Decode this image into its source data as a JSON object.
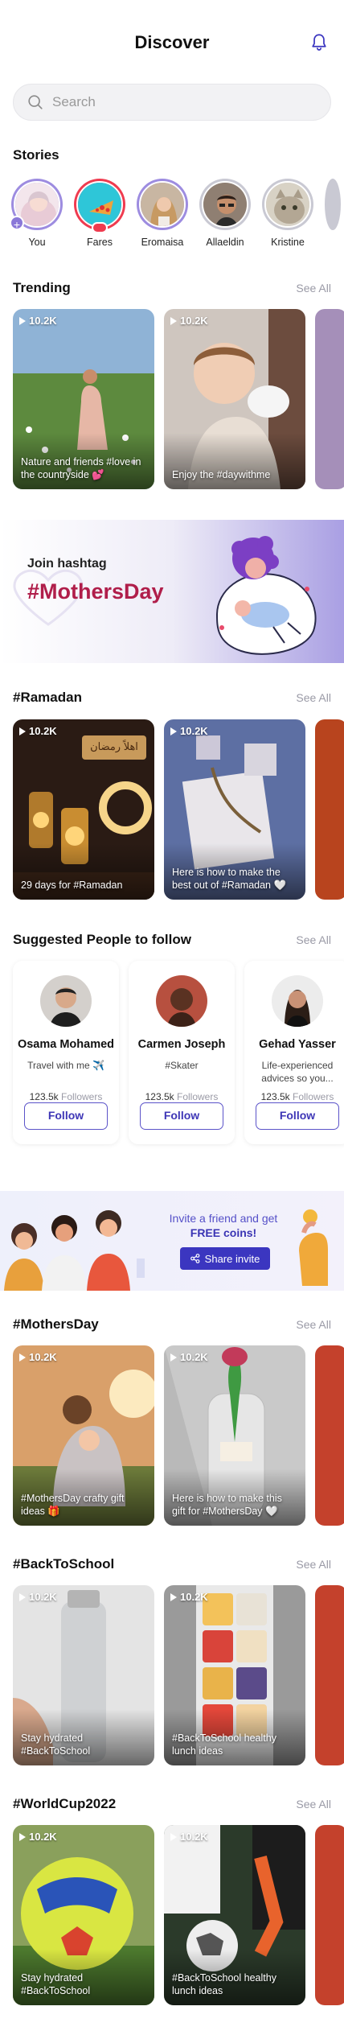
{
  "header": {
    "title": "Discover"
  },
  "search": {
    "placeholder": "Search"
  },
  "stories": {
    "title": "Stories",
    "items": [
      {
        "label": "You"
      },
      {
        "label": "Fares"
      },
      {
        "label": "Eromaisa"
      },
      {
        "label": "Allaeldin"
      },
      {
        "label": "Kristine"
      }
    ]
  },
  "trending": {
    "title": "Trending",
    "see_all": "See All",
    "cards": [
      {
        "views": "10.2K",
        "caption": "Nature and friends #love in the countryside 💕"
      },
      {
        "views": "10.2K",
        "caption": "Enjoy the #daywithme"
      }
    ]
  },
  "banner": {
    "join": "Join hashtag",
    "tag": "#MothersDay"
  },
  "ramadan": {
    "title": "#Ramadan",
    "see_all": "See All",
    "cards": [
      {
        "views": "10.2K",
        "caption": "29 days for #Ramadan",
        "sign": "اهلاً رمضان"
      },
      {
        "views": "10.2K",
        "caption": "Here is how to make the best out of #Ramadan 🤍"
      }
    ]
  },
  "suggested": {
    "title": "Suggested People to follow",
    "see_all": "See All",
    "people": [
      {
        "name": "Osama Mohamed",
        "bio": "Travel with me ✈️",
        "followers": "123.5k",
        "followers_label": "Followers",
        "button": "Follow"
      },
      {
        "name": "Carmen Joseph",
        "bio": "#Skater",
        "followers": "123.5k",
        "followers_label": "Followers",
        "button": "Follow"
      },
      {
        "name": "Gehad Yasser",
        "bio": "Life-experienced advices so you...",
        "followers": "123.5k",
        "followers_label": "Followers",
        "button": "Follow"
      }
    ]
  },
  "invite": {
    "line1": "Invite a friend and get",
    "line2": "FREE coins!",
    "button": "Share invite"
  },
  "mothersday": {
    "title": "#MothersDay",
    "see_all": "See All",
    "cards": [
      {
        "views": "10.2K",
        "caption": "#MothersDay crafty gift ideas 🎁"
      },
      {
        "views": "10.2K",
        "caption": "Here is how to make this gift for #MothersDay 🤍"
      }
    ]
  },
  "backtoschool": {
    "title": "#BackToSchool",
    "see_all": "See All",
    "cards": [
      {
        "views": "10.2K",
        "caption": "Stay hydrated #BackToSchool"
      },
      {
        "views": "10.2K",
        "caption": "#BackToSchool healthy lunch ideas"
      }
    ]
  },
  "worldcup": {
    "title": "#WorldCup2022",
    "see_all": "See All",
    "cards": [
      {
        "views": "10.2K",
        "caption": "Stay hydrated #BackToSchool"
      },
      {
        "views": "10.2K",
        "caption": "#BackToSchool healthy lunch ideas"
      }
    ]
  },
  "colors": {
    "accent": "#3b36c0",
    "hashtag": "#b01e4a",
    "live": "#ef3b4f",
    "story_ring": "#9d8ce0"
  },
  "icons": {
    "notifications": "bell-icon",
    "search": "search-icon",
    "views": "play-icon",
    "share": "share-icon"
  }
}
